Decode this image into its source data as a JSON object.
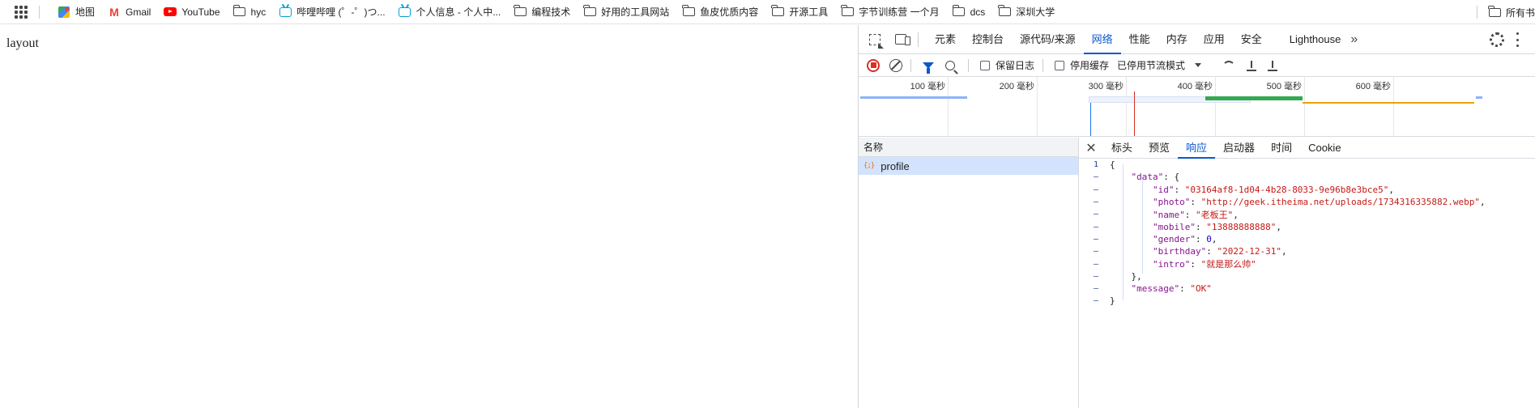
{
  "bookmarks": {
    "items": [
      {
        "label": "地图",
        "icon": "maps-icon"
      },
      {
        "label": "Gmail",
        "icon": "gmail-icon"
      },
      {
        "label": "YouTube",
        "icon": "youtube-icon"
      },
      {
        "label": "hyc",
        "icon": "folder-icon"
      },
      {
        "label": "哔哩哔哩 (゜-゜)つ...",
        "icon": "bilibili-icon"
      },
      {
        "label": "个人信息 - 个人中...",
        "icon": "bilibili-icon"
      },
      {
        "label": "编程技术",
        "icon": "folder-icon"
      },
      {
        "label": "好用的工具网站",
        "icon": "folder-icon"
      },
      {
        "label": "鱼皮优质内容",
        "icon": "folder-icon"
      },
      {
        "label": "开源工具",
        "icon": "folder-icon"
      },
      {
        "label": "字节训练营 一个月",
        "icon": "folder-icon"
      },
      {
        "label": "dcs",
        "icon": "folder-icon"
      },
      {
        "label": "深圳大学",
        "icon": "folder-icon"
      }
    ],
    "all_bookmarks": "所有书"
  },
  "page": {
    "text": "layout"
  },
  "devtools": {
    "tabs": [
      "元素",
      "控制台",
      "源代码/来源",
      "网络",
      "性能",
      "内存",
      "应用",
      "安全",
      "Lighthouse"
    ],
    "active_tab": "网络",
    "toolbar": {
      "preserve_log": "保留日志",
      "disable_cache": "停用缓存",
      "throttle": "已停用节流模式"
    },
    "timeline": {
      "ticks": [
        "100 毫秒",
        "200 毫秒",
        "300 毫秒",
        "400 毫秒",
        "500 毫秒",
        "600 毫秒"
      ]
    },
    "name_header": "名称",
    "requests": [
      {
        "name": "profile"
      }
    ],
    "detail_tabs": [
      "标头",
      "预览",
      "响应",
      "启动器",
      "时间",
      "Cookie"
    ],
    "active_detail_tab": "响应",
    "response": {
      "line_number": "1",
      "data_key": "data",
      "fields": [
        {
          "key": "id",
          "value": "03164af8-1d04-4b28-8033-9e96b8e3bce5",
          "type": "string"
        },
        {
          "key": "photo",
          "value": "http://geek.itheima.net/uploads/1734316335882.webp",
          "type": "string"
        },
        {
          "key": "name",
          "value": "老板王",
          "type": "string"
        },
        {
          "key": "mobile",
          "value": "13888888888",
          "type": "string"
        },
        {
          "key": "gender",
          "value": "0",
          "type": "number"
        },
        {
          "key": "birthday",
          "value": "2022-12-31",
          "type": "string"
        },
        {
          "key": "intro",
          "value": "就是那么帅",
          "type": "string"
        }
      ],
      "message_key": "message",
      "message_value": "OK"
    }
  }
}
